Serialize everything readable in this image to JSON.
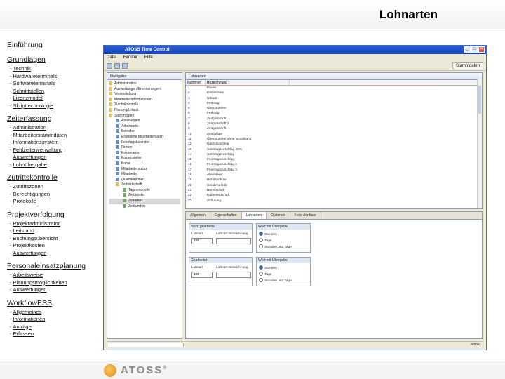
{
  "slide": {
    "title": "Lohnarten"
  },
  "nav": {
    "sections": [
      {
        "title": "Einführung",
        "items": []
      },
      {
        "title": "Grundlagen",
        "items": [
          "Technik",
          "Hardwareterminals",
          "Softwareterminals",
          "Schnittstellen",
          "Lizenzmodell",
          "Skripttechnologie"
        ]
      },
      {
        "title": "Zeiterfassung",
        "items": [
          "Administration",
          "Mitarbeiterstammdaten",
          "Informationssystem",
          "Fehlzeitenverwaltung",
          "Auswertungen",
          "Lohnübergabe"
        ]
      },
      {
        "title": "Zutrittskontrolle",
        "items": [
          "Zutrittszonen",
          "Berechtigungen",
          "Protokolle"
        ]
      },
      {
        "title": "Projektverfolgung",
        "items": [
          "Projektadministrator",
          "Leitstand",
          "Buchungsübersicht",
          "Projektkosten",
          "Auswertungen"
        ]
      },
      {
        "title": "Personaleinsatzplanung",
        "items": [
          "Arbeitsweise",
          "Planungsmöglichkeiten",
          "Auswertungen"
        ]
      },
      {
        "title": "WorkflowESS",
        "items": [
          "Allgemeines",
          "Informationen",
          "Anträge",
          "Erfassen"
        ]
      }
    ]
  },
  "app": {
    "window_title": "ATOSS Time Control",
    "menu": [
      "Datei",
      "Fenster",
      "Hilfe"
    ],
    "perspective": "Stammdaten",
    "navigator_tab": "Navigator",
    "list_tab": "Lohnarten",
    "tree": [
      {
        "label": "Administration",
        "level": 0,
        "icon": "folder"
      },
      {
        "label": "Auswertungen/Erweiterungen",
        "level": 0,
        "icon": "folder"
      },
      {
        "label": "Voreinstellung",
        "level": 0,
        "icon": "folder"
      },
      {
        "label": "Mitarbeiterinformationen",
        "level": 0,
        "icon": "folder"
      },
      {
        "label": "Zutrittskontrolle",
        "level": 0,
        "icon": "folder"
      },
      {
        "label": "Planung/Urlaub",
        "level": 0,
        "icon": "folder"
      },
      {
        "label": "Stammdaten",
        "level": 0,
        "icon": "folder"
      },
      {
        "label": "Abteilungen",
        "level": 1,
        "icon": "blue"
      },
      {
        "label": "Arbeitsorte",
        "level": 1,
        "icon": "blue"
      },
      {
        "label": "Betriebe",
        "level": 1,
        "icon": "blue"
      },
      {
        "label": "Erweiterte Mitarbeiterdaten",
        "level": 1,
        "icon": "blue"
      },
      {
        "label": "Feiertagskalender",
        "level": 1,
        "icon": "blue"
      },
      {
        "label": "Firmen",
        "level": 1,
        "icon": "blue"
      },
      {
        "label": "Kostenarten",
        "level": 1,
        "icon": "blue"
      },
      {
        "label": "Kostenstellen",
        "level": 1,
        "icon": "blue"
      },
      {
        "label": "Kurse",
        "level": 1,
        "icon": "blue"
      },
      {
        "label": "Mitarbeiterstatus",
        "level": 1,
        "icon": "blue"
      },
      {
        "label": "Mitarbeiter",
        "level": 1,
        "icon": "blue"
      },
      {
        "label": "Qualifikationen",
        "level": 1,
        "icon": "blue"
      },
      {
        "label": "Zeitwirtschaft",
        "level": 1,
        "icon": "folder"
      },
      {
        "label": "Tagesmodelle",
        "level": 2,
        "icon": "green"
      },
      {
        "label": "Zeitfenster",
        "level": 2,
        "icon": "green"
      },
      {
        "label": "Zeitarten",
        "level": 2,
        "icon": "green",
        "selected": true
      },
      {
        "label": "Zeitrunden",
        "level": 2,
        "icon": "green"
      }
    ],
    "list": {
      "headers": [
        "Nummer",
        "Bezeichnung"
      ],
      "rows": [
        [
          "1",
          "Pause"
        ],
        [
          "2",
          "Dienstreise"
        ],
        [
          "3",
          "Urlaub"
        ],
        [
          "4",
          "Feiertag"
        ],
        [
          "5",
          "Überstunden"
        ],
        [
          "6",
          "Feiertag"
        ],
        [
          "7",
          "Zeitgutschrift"
        ],
        [
          "8",
          "Zeitgutschrift 2"
        ],
        [
          "9",
          "Zeitgutschrift"
        ],
        [
          "10",
          "Zuschläge"
        ],
        [
          "11",
          "Überstunden ohne Bezahlung"
        ],
        [
          "12",
          "Nachtzuschlag"
        ],
        [
          "13",
          "Sonntagszuschlag 25%"
        ],
        [
          "14",
          "Sonntagszuschlag"
        ],
        [
          "15",
          "Feiertagszuschlag"
        ],
        [
          "16",
          "Feiertagszuschlag 2"
        ],
        [
          "17",
          "Feiertagszuschlag 3"
        ],
        [
          "18",
          "Abwesend"
        ],
        [
          "19",
          "Berufsschule"
        ],
        [
          "20",
          "Sonderurlaub"
        ],
        [
          "21",
          "Bereitschaft"
        ],
        [
          "22",
          "Rufbereitschaft"
        ],
        [
          "23",
          "Schulung"
        ]
      ]
    },
    "detail_tabs": [
      "Allgemein",
      "Eigenschaften",
      "Lohnarten",
      "Optionen",
      "Freie Attribute"
    ],
    "detail_active_tab": 2,
    "group1": {
      "title": "Nicht gearbeitet",
      "left_label": "Lohnart",
      "right_label": "Lohnart-Bezeichnung",
      "value": "100",
      "radio_title": "Wert mit Übergabe",
      "radios": [
        "Stunden",
        "Tage",
        "Stunden und Tage"
      ]
    },
    "group2": {
      "title": "Gearbeitet",
      "left_label": "Lohnart",
      "right_label": "Lohnart-Bezeichnung",
      "value": "100",
      "radio_title": "Wert mit Übergabe",
      "radios": [
        "Stunden",
        "Tage",
        "Stunden und Tage"
      ]
    },
    "status_user": "admin"
  },
  "footer": {
    "logo_text": "ATOSS"
  }
}
